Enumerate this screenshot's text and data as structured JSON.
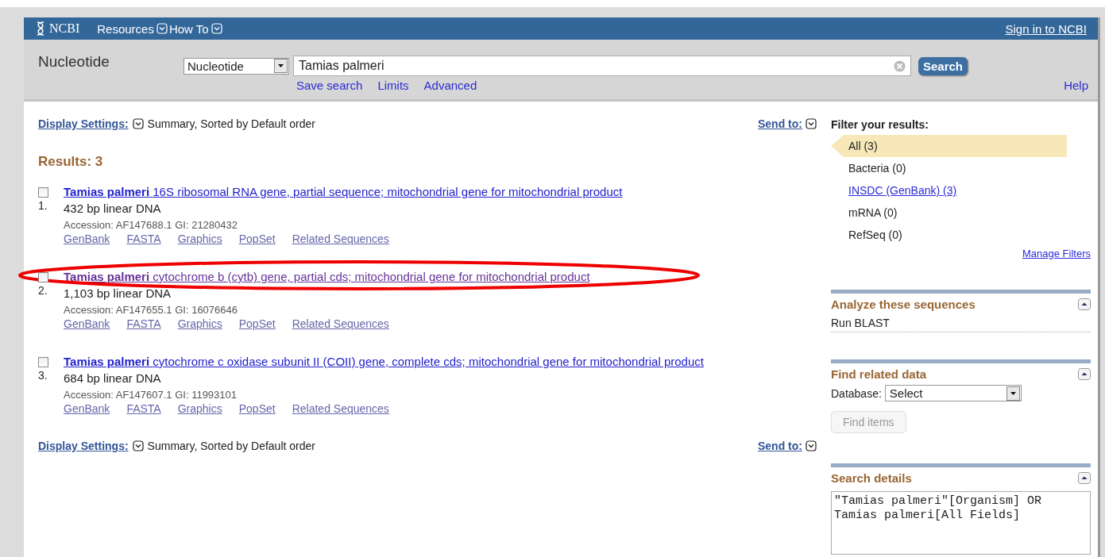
{
  "header": {
    "logo": "NCBI",
    "menus": [
      "Resources",
      "How To"
    ],
    "sign_in": "Sign in to NCBI"
  },
  "search": {
    "title": "Nucleotide",
    "database": "Nucleotide",
    "value": "Tamias palmeri",
    "button": "Search",
    "links": [
      "Save search",
      "Limits",
      "Advanced"
    ],
    "help": "Help"
  },
  "display_top": {
    "label": "Display Settings:",
    "summary": "Summary, Sorted by Default order",
    "send_to": "Send to:"
  },
  "results_heading": "Results: 3",
  "results": [
    {
      "number": "1.",
      "checked": false,
      "visited": false,
      "circled": false,
      "organism": "Tamias palmeri",
      "title": "16S ribosomal RNA gene, partial sequence; mitochondrial gene for mitochondrial product",
      "description": "432 bp linear DNA",
      "accession": "Accession: AF147688.1 GI: 21280432",
      "links": [
        "GenBank",
        "FASTA",
        "Graphics",
        "PopSet",
        "Related Sequences"
      ]
    },
    {
      "number": "2.",
      "checked": false,
      "visited": true,
      "circled": true,
      "organism": "Tamias palmeri",
      "title": "cytochrome b (cytb) gene, partial cds; mitochondrial gene for mitochondrial product",
      "description": "1,103 bp linear DNA",
      "accession": "Accession: AF147655.1 GI: 16076646",
      "links": [
        "GenBank",
        "FASTA",
        "Graphics",
        "PopSet",
        "Related Sequences"
      ]
    },
    {
      "number": "3.",
      "checked": false,
      "visited": false,
      "circled": false,
      "organism": "Tamias palmeri",
      "title": "cytochrome c oxidase subunit II (COII) gene, complete cds; mitochondrial gene for mitochondrial product",
      "description": "684 bp linear DNA",
      "accession": "Accession: AF147607.1 GI: 11993101",
      "links": [
        "GenBank",
        "FASTA",
        "Graphics",
        "PopSet",
        "Related Sequences"
      ]
    }
  ],
  "display_bottom": {
    "label": "Display Settings:",
    "summary": "Summary, Sorted by Default order",
    "send_to": "Send to:"
  },
  "sidebar": {
    "filter_title": "Filter your results:",
    "filters": [
      {
        "label": "All (3)",
        "selected": true,
        "kind": "text"
      },
      {
        "label": "Bacteria (0)",
        "selected": false,
        "kind": "text"
      },
      {
        "label": "INSDC (GenBank) (3)",
        "selected": false,
        "kind": "link"
      },
      {
        "label": "mRNA (0)",
        "selected": false,
        "kind": "text"
      },
      {
        "label": "RefSeq (0)",
        "selected": false,
        "kind": "text"
      }
    ],
    "manage_filters": "Manage Filters",
    "analyze": {
      "title": "Analyze these sequences",
      "link": "Run BLAST"
    },
    "related": {
      "title": "Find related data",
      "database_label": "Database:",
      "database_value": "Select",
      "button": "Find items",
      "disabled": true
    },
    "details": {
      "title": "Search details",
      "query": "\"Tamias palmeri\"[Organism] OR Tamias palmeri[All Fields]"
    }
  }
}
